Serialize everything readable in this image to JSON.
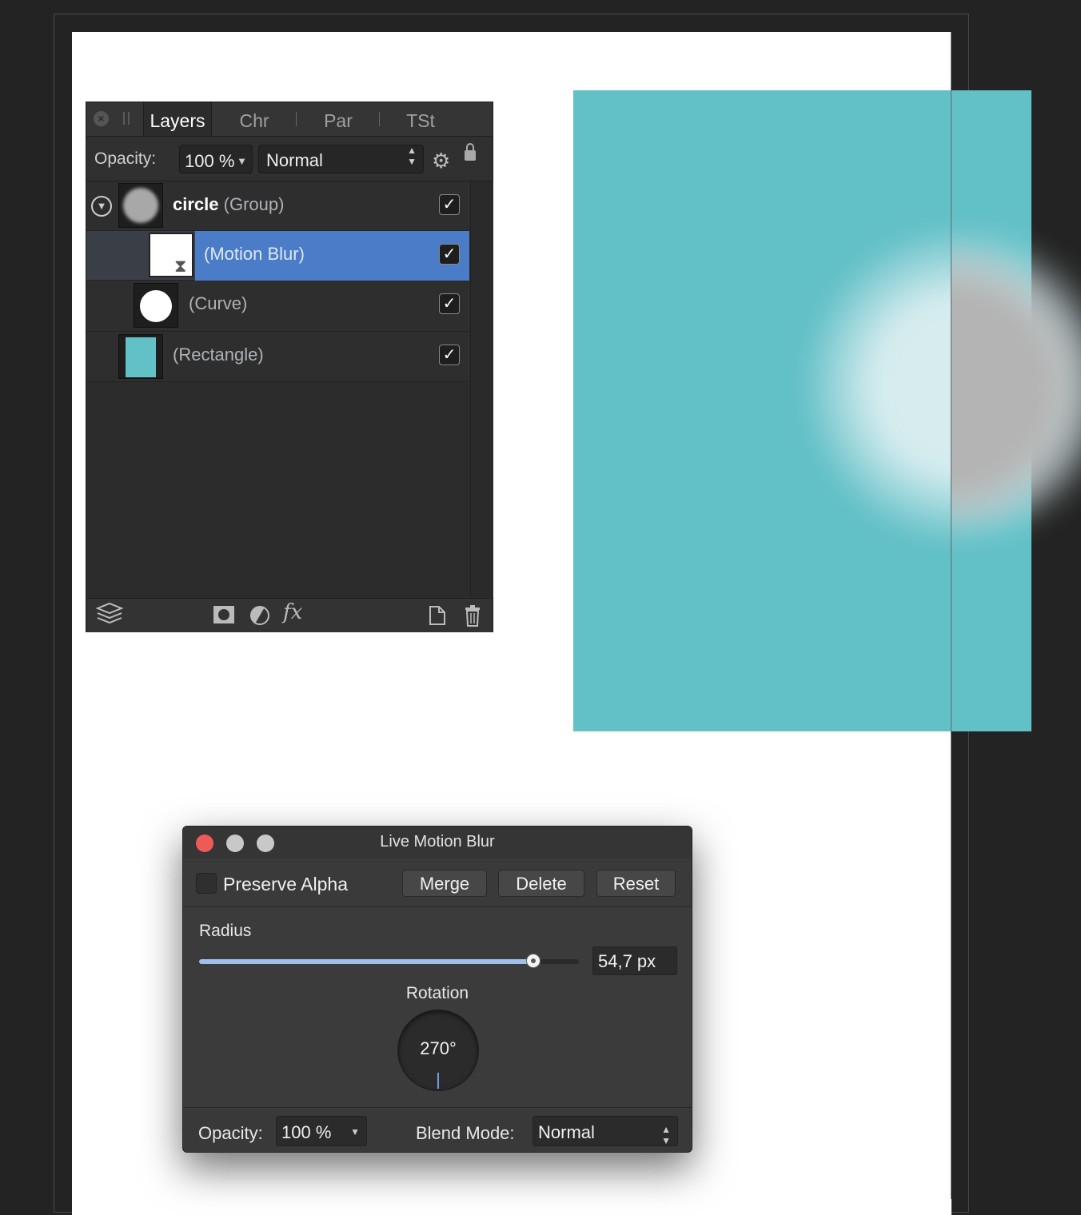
{
  "layers_panel": {
    "tabs": [
      "Layers",
      "Chr",
      "Par",
      "TSt"
    ],
    "opacity_label": "Opacity:",
    "opacity_value": "100 %",
    "blend_mode": "Normal",
    "layers": [
      {
        "name": "circle",
        "type": "(Group)",
        "visible": "✓"
      },
      {
        "name": "",
        "type": "(Motion Blur)",
        "visible": "✓"
      },
      {
        "name": "",
        "type": "(Curve)",
        "visible": "✓"
      },
      {
        "name": "",
        "type": "(Rectangle)",
        "visible": "✓"
      }
    ],
    "footer_icons": [
      "layers-stack-icon",
      "mask-icon",
      "adjustment-icon",
      "fx-icon",
      "new-layer-icon",
      "trash-icon"
    ],
    "fx_label": "fx"
  },
  "dialog": {
    "title": "Live Motion Blur",
    "preserve_alpha_label": "Preserve Alpha",
    "merge_label": "Merge",
    "delete_label": "Delete",
    "reset_label": "Reset",
    "radius_label": "Radius",
    "radius_value": "54,7 px",
    "radius_slider_fraction": 0.88,
    "rotation_label": "Rotation",
    "rotation_value": "270°",
    "opacity_label": "Opacity:",
    "opacity_value": "100 %",
    "blend_mode_label": "Blend Mode:",
    "blend_mode_value": "Normal"
  },
  "colors": {
    "rectangle": "#62c0c7",
    "selection": "#4a7cc7",
    "close_dot": "#ee5a56",
    "inactive_dot": "#c8c8c8"
  }
}
